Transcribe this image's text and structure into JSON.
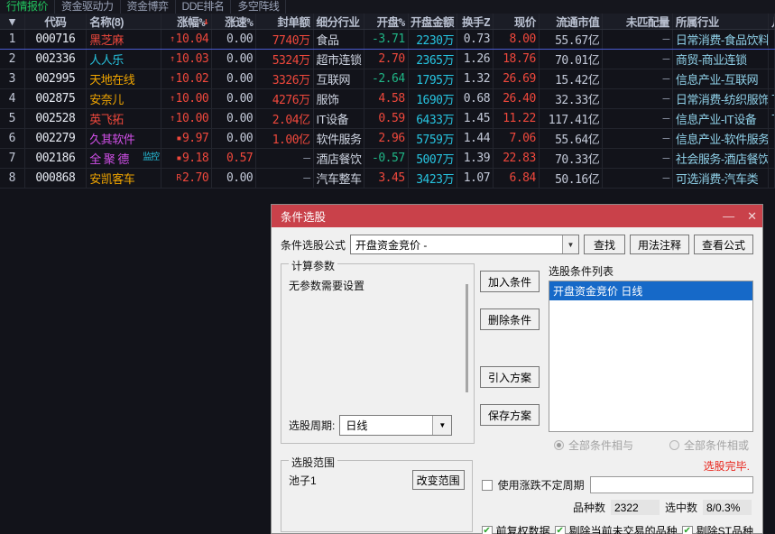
{
  "menubar": {
    "items": [
      {
        "label": "行情报价",
        "active": true
      },
      {
        "label": "资金驱动力",
        "active": false
      },
      {
        "label": "资金博弈",
        "active": false
      },
      {
        "label": "DDE排名",
        "active": false
      },
      {
        "label": "多空阵线",
        "active": false
      }
    ]
  },
  "table": {
    "headers": {
      "index": "▼",
      "code": "代码",
      "name": "名称(8)",
      "change": "涨幅%",
      "speed": "涨速%",
      "seal": "封单额",
      "industry": "细分行业",
      "open_pct": "开盘%",
      "open_amt": "开盘金额",
      "turnover": "换手Z",
      "price": "现价",
      "mcap": "流通市值",
      "unmatched": "未匹配量",
      "sector": "所属行业",
      "last": "几"
    },
    "rows": [
      {
        "idx": "1",
        "code": "000716",
        "name": "黑芝麻",
        "name_color": "#f0483c",
        "tag": "",
        "change": "10.04",
        "change_arrow": "↑",
        "speed": "0.00",
        "seal": "7740万",
        "industry": "食品",
        "open_pct": "-3.71",
        "open_pct_dir": "down",
        "open_amt": "2230万",
        "turnover": "0.73",
        "price": "8.00",
        "price_dir": "up",
        "mcap": "55.67亿",
        "unmatched": "—",
        "sector": "日常消费-食品饮料",
        "last": ""
      },
      {
        "idx": "2",
        "code": "002336",
        "name": "人人乐",
        "name_color": "#27c4e0",
        "tag": "",
        "change": "10.03",
        "change_arrow": "↑",
        "speed": "0.00",
        "seal": "5324万",
        "industry": "超市连锁",
        "open_pct": "2.70",
        "open_pct_dir": "up",
        "open_amt": "2365万",
        "turnover": "1.26",
        "price": "18.76",
        "price_dir": "up",
        "mcap": "70.01亿",
        "unmatched": "—",
        "sector": "商贸-商业连锁",
        "last": ""
      },
      {
        "idx": "3",
        "code": "002995",
        "name": "天地在线",
        "name_color": "#f0a500",
        "tag": "",
        "change": "10.02",
        "change_arrow": "↑",
        "speed": "0.00",
        "seal": "3326万",
        "industry": "互联网",
        "open_pct": "-2.64",
        "open_pct_dir": "down",
        "open_amt": "1795万",
        "turnover": "1.32",
        "price": "26.69",
        "price_dir": "up",
        "mcap": "15.42亿",
        "unmatched": "—",
        "sector": "信息产业-互联网",
        "last": ""
      },
      {
        "idx": "4",
        "code": "002875",
        "name": "安奈儿",
        "name_color": "#f0a500",
        "tag": "",
        "change": "10.00",
        "change_arrow": "↑",
        "speed": "0.00",
        "seal": "4276万",
        "industry": "服饰",
        "open_pct": "4.58",
        "open_pct_dir": "up",
        "open_amt": "1690万",
        "turnover": "0.68",
        "price": "26.40",
        "price_dir": "up",
        "mcap": "32.33亿",
        "unmatched": "—",
        "sector": "日常消费-纺织服饰",
        "last": "下"
      },
      {
        "idx": "5",
        "code": "002528",
        "name": "英飞拓",
        "name_color": "#f0483c",
        "tag": "",
        "change": "10.00",
        "change_arrow": "↑",
        "speed": "0.00",
        "seal": "2.04亿",
        "industry": "IT设备",
        "open_pct": "0.59",
        "open_pct_dir": "up",
        "open_amt": "6433万",
        "turnover": "1.45",
        "price": "11.22",
        "price_dir": "up",
        "mcap": "117.41亿",
        "unmatched": "—",
        "sector": "信息产业-IT设备",
        "last": "下"
      },
      {
        "idx": "6",
        "code": "002279",
        "name": "久其软件",
        "name_color": "#d14fe8",
        "tag": "",
        "change": "9.97",
        "change_arrow": "▪",
        "speed": "0.00",
        "seal": "1.00亿",
        "industry": "软件服务",
        "open_pct": "2.96",
        "open_pct_dir": "up",
        "open_amt": "5759万",
        "turnover": "1.44",
        "price": "7.06",
        "price_dir": "up",
        "mcap": "55.64亿",
        "unmatched": "—",
        "sector": "信息产业-软件服务",
        "last": ""
      },
      {
        "idx": "7",
        "code": "002186",
        "name": "全 聚 德",
        "name_color": "#d14fe8",
        "tag": "监控",
        "change": "9.18",
        "change_arrow": "▪",
        "speed": "0.57",
        "seal": "—",
        "industry": "酒店餐饮",
        "open_pct": "-0.57",
        "open_pct_dir": "down",
        "open_amt": "5007万",
        "turnover": "1.39",
        "price": "22.83",
        "price_dir": "up",
        "mcap": "70.33亿",
        "unmatched": "—",
        "sector": "社会服务-酒店餐饮",
        "last": ""
      },
      {
        "idx": "8",
        "code": "000868",
        "name": "安凯客车",
        "name_color": "#f0a500",
        "tag": "",
        "change": "2.70",
        "change_arrow": "R",
        "speed": "0.00",
        "seal": "—",
        "industry": "汽车整车",
        "open_pct": "3.45",
        "open_pct_dir": "up",
        "open_amt": "3423万",
        "turnover": "1.07",
        "price": "6.84",
        "price_dir": "up",
        "mcap": "50.16亿",
        "unmatched": "—",
        "sector": "可选消费-汽车类",
        "last": ""
      }
    ]
  },
  "dialog": {
    "title": "条件选股",
    "minimize": "—",
    "close": "✕",
    "formula_label": "条件选股公式",
    "formula_value": "开盘资金竞价 -",
    "btn_search": "查找",
    "btn_usage": "用法注释",
    "btn_view": "查看公式",
    "calc_params_legend": "计算参数",
    "no_params_text": "无参数需要设置",
    "period_label": "选股周期:",
    "period_value": "日线",
    "btn_add_condition": "加入条件",
    "btn_del_condition": "删除条件",
    "btn_import_plan": "引入方案",
    "btn_save_plan": "保存方案",
    "condition_list_label": "选股条件列表",
    "condition_items": [
      "开盘资金竞价  日线"
    ],
    "radio_and": "全部条件相与",
    "radio_or": "全部条件相或",
    "scope_legend": "选股范围",
    "scope_value": "池子1",
    "btn_change_scope": "改变范围",
    "done_message": "选股完毕.",
    "use_undetermined_label": "使用涨跌不定周期",
    "use_undetermined_value": "",
    "count_label": "品种数",
    "count_value": "2322",
    "selected_label": "选中数",
    "selected_value": "8/0.3%",
    "cb_forward_adjust": "前复权数据",
    "cb_exclude_untraded": "剔除当前未交易的品种",
    "cb_exclude_st": "剔除ST品种"
  },
  "colors": {
    "accent_red": "#c9414a",
    "up": "#f0483c",
    "down": "#1fb686",
    "list_select": "#1669c8",
    "done_red": "#e8251c"
  }
}
